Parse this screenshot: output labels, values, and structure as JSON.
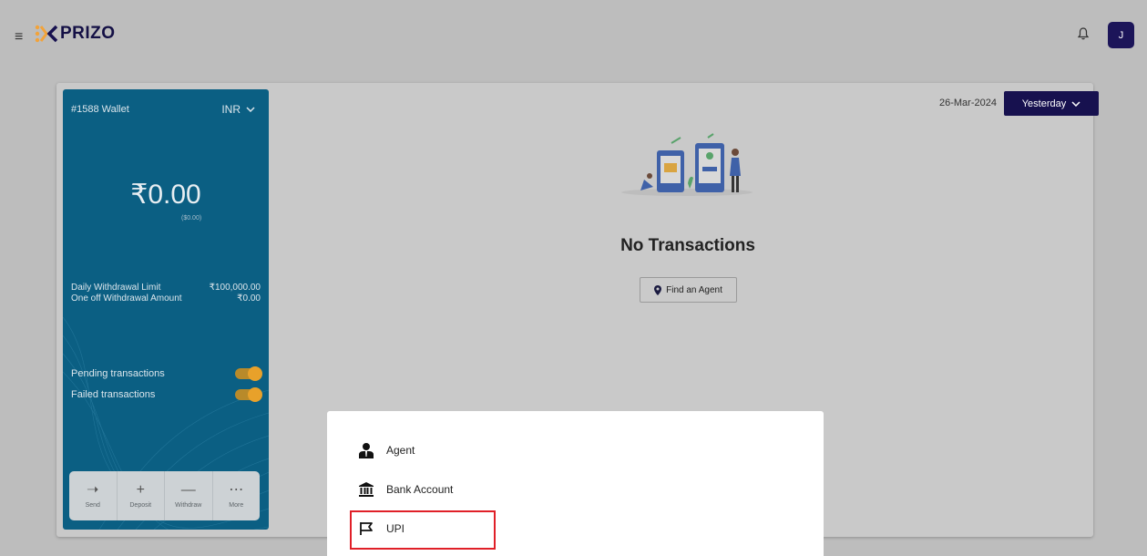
{
  "header": {
    "brand": "PRIZO",
    "avatar_initial": "J"
  },
  "wallet": {
    "title": "#1588 Wallet",
    "currency": "INR",
    "balance": "₹0.00",
    "balance_usd": "($0.00)",
    "limits": [
      {
        "label": "Daily Withdrawal Limit",
        "value": "₹100,000.00"
      },
      {
        "label": "One off Withdrawal Amount",
        "value": "₹0.00"
      }
    ],
    "toggles": [
      {
        "label": "Pending transactions",
        "on": true
      },
      {
        "label": "Failed transactions",
        "on": true
      }
    ],
    "actions": [
      {
        "label": "Send",
        "icon": "arrow-right-icon"
      },
      {
        "label": "Deposit",
        "icon": "plus-icon"
      },
      {
        "label": "Withdraw",
        "icon": "minus-icon"
      },
      {
        "label": "More",
        "icon": "more-dots-icon"
      }
    ],
    "accent_color": "#0b5f83"
  },
  "transactions": {
    "date": "26-Mar-2024",
    "period": "Yesterday",
    "empty_title": "No Transactions",
    "find_agent_label": "Find an Agent"
  },
  "sheet": {
    "items": [
      {
        "label": "Agent",
        "icon": "agent-icon"
      },
      {
        "label": "Bank Account",
        "icon": "bank-icon"
      },
      {
        "label": "UPI",
        "icon": "flag-icon"
      }
    ]
  },
  "colors": {
    "brand_navy": "#17114f",
    "brand_orange": "#f2a33a",
    "highlight_red": "#e02028"
  }
}
